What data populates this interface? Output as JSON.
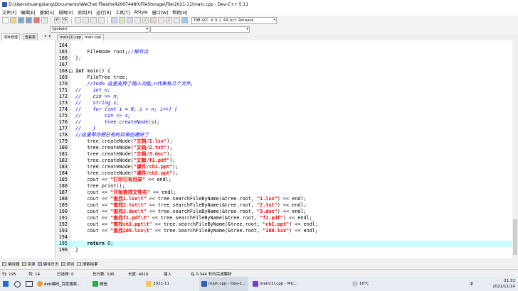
{
  "window": {
    "title": "D:\\Users\\huangxiang\\Documents\\WeChat Files\\hx429074480\\FileStorage\\File\\2021-11\\main.cpp - Dev-C++ 5.11"
  },
  "menu": [
    "文件[F]",
    "编辑[E]",
    "搜索[S]",
    "视图[V]",
    "项目[P]",
    "运行[R]",
    "工具[T]",
    "AStyle",
    "窗口[W]",
    "帮助[H]"
  ],
  "toolbar": {
    "compiler": "TDM-GCC 4.9.2 64-bit Release",
    "scope": "(globals)"
  },
  "left_tabs": [
    "项目管理",
    "查看类"
  ],
  "editor_tabs": [
    "main(1).cpp",
    "main.cpp"
  ],
  "code": [
    {
      "n": "164",
      "t": ""
    },
    {
      "n": "165",
      "t": "    FileNode root;//根节点"
    },
    {
      "n": "166",
      "t": "};",
      "fold": "end"
    },
    {
      "n": "167",
      "t": ""
    },
    {
      "n": "168",
      "t": "int main() {",
      "fold": "start"
    },
    {
      "n": "169",
      "t": "    FileTree tree;"
    },
    {
      "n": "170",
      "t": "    //todo 这里支持了插入功能,n代表有几个文件,"
    },
    {
      "n": "171",
      "t": "//    int n;"
    },
    {
      "n": "172",
      "t": "//    cin >> n;"
    },
    {
      "n": "173",
      "t": "//    string s;"
    },
    {
      "n": "174",
      "t": "//    for (int i = 0; i < n; i++) {"
    },
    {
      "n": "175",
      "t": "//        cin >> s;"
    },
    {
      "n": "176",
      "t": "//        tree.createNode(s);"
    },
    {
      "n": "177",
      "t": "//    }"
    },
    {
      "n": "178",
      "t": "//这里帮你把已有的目录创建好了"
    },
    {
      "n": "179",
      "t": "    tree.createNode(\"文档/1.lsx\");"
    },
    {
      "n": "180",
      "t": "    tree.createNode(\"文档/2.txt\");"
    },
    {
      "n": "181",
      "t": "    tree.createNode(\"文档/3.doc\");"
    },
    {
      "n": "182",
      "t": "    tree.createNode(\"文献/f1.pdf\");"
    },
    {
      "n": "183",
      "t": "    tree.createNode(\"课件/ch1.ppt\");"
    },
    {
      "n": "184",
      "t": "    tree.createNode(\"课件/ch2.ppt\");"
    },
    {
      "n": "185",
      "t": "    cout << \"打印已有目录\" << endl;"
    },
    {
      "n": "186",
      "t": "    tree.print();"
    },
    {
      "n": "187",
      "t": "    cout << \"开始查找文件名\" << endl;"
    },
    {
      "n": "188",
      "t": "    cout << \"查找1.lsx\\t\" << tree.searchFileByName(&tree.root, \"1.lsx\") << endl;"
    },
    {
      "n": "189",
      "t": "    cout << \"查找2.txt\\t\" << tree.searchFileByName(&tree.root, \"2.txt\") << endl;"
    },
    {
      "n": "190",
      "t": "    cout << \"查找3.doc\\t\" << tree.searchFileByName(&tree.root, \"3.doc\") << endl;"
    },
    {
      "n": "191",
      "t": "    cout << \"查找f1.pdf\\t\" << tree.searchFileByName(&tree.root, \"f1.pdf\") << endl;"
    },
    {
      "n": "192",
      "t": "    cout << \"查找ch1.ppt\\t\" << tree.searchFileByName(&tree.root, \"ch1.ppt\") << endl;"
    },
    {
      "n": "193",
      "t": "    cout << \"查找100.lsx\\t\" << tree.searchFileByName(&tree.root, \"100.lsx\") << endl;"
    },
    {
      "n": "194",
      "t": ""
    },
    {
      "n": "195",
      "t": "    return 0;",
      "current": true
    },
    {
      "n": "196",
      "t": "}",
      "fold": "end"
    }
  ],
  "bottom_tabs": [
    "编译器",
    "资源",
    "编译日志",
    "调试",
    "搜索结果"
  ],
  "status": {
    "row_label": "行:",
    "row": "195",
    "col_label": "列:",
    "col": "14",
    "sel_label": "已选择:",
    "sel": "0",
    "total_label": "总行数:",
    "total": "196",
    "len_label": "长度:",
    "len": "4616",
    "mode": "插入",
    "parse": "在 0.344 秒内完成解析"
  },
  "taskbar": {
    "items": [
      "deb编码_百度搜索...",
      "微信",
      "2021-11",
      "main.cpp - Dev-C...",
      "main(1).cpp - Mic..."
    ],
    "weather": "10°C",
    "ime": "中",
    "time": "21:31",
    "date": "2021/11/14"
  }
}
